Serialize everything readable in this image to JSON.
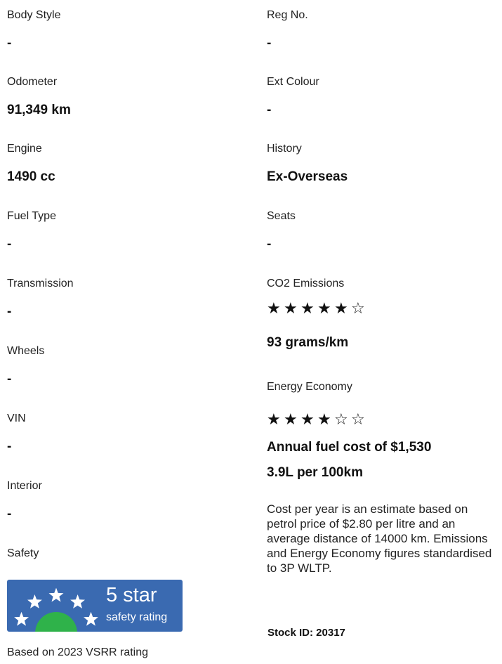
{
  "left_specs": [
    {
      "label": "Body Style",
      "value": "-"
    },
    {
      "label": "Odometer",
      "value": "91,349 km"
    },
    {
      "label": "Engine",
      "value": "1490 cc"
    },
    {
      "label": "Fuel Type",
      "value": "-"
    },
    {
      "label": "Transmission",
      "value": "-"
    },
    {
      "label": "Wheels",
      "value": "-"
    },
    {
      "label": "VIN",
      "value": "-"
    },
    {
      "label": "Interior",
      "value": "-"
    }
  ],
  "safety": {
    "label": "Safety",
    "badge_big": "5 star",
    "badge_small": "safety rating",
    "badge_stars": 5,
    "note": "Based on 2023 VSRR rating"
  },
  "right_specs": [
    {
      "label": "Reg No.",
      "value": "-"
    },
    {
      "label": "Ext Colour",
      "value": "-"
    },
    {
      "label": "History",
      "value": "Ex-Overseas"
    },
    {
      "label": "Seats",
      "value": "-"
    }
  ],
  "co2": {
    "label": "CO2 Emissions",
    "rating": 5,
    "rating_max": 6,
    "value": "93 grams/km"
  },
  "energy": {
    "label": "Energy Economy",
    "rating": 4,
    "rating_max": 6,
    "annual_cost": "Annual fuel cost of $1,530",
    "consumption": "3.9L per 100km"
  },
  "disclaimer": "Cost per year is an estimate based on petrol price of  $2.80 per litre and an average distance of 14000 km. Emissions and Energy Economy figures standardised to 3P WLTP.",
  "stock_id": "Stock ID: 20317",
  "colors": {
    "badge_bg": "#3a6ab1",
    "badge_arc": "#2fb24a",
    "star": "#111111"
  },
  "icons": {
    "filled_star": "filled-star-icon",
    "empty_star": "empty-star-icon"
  }
}
